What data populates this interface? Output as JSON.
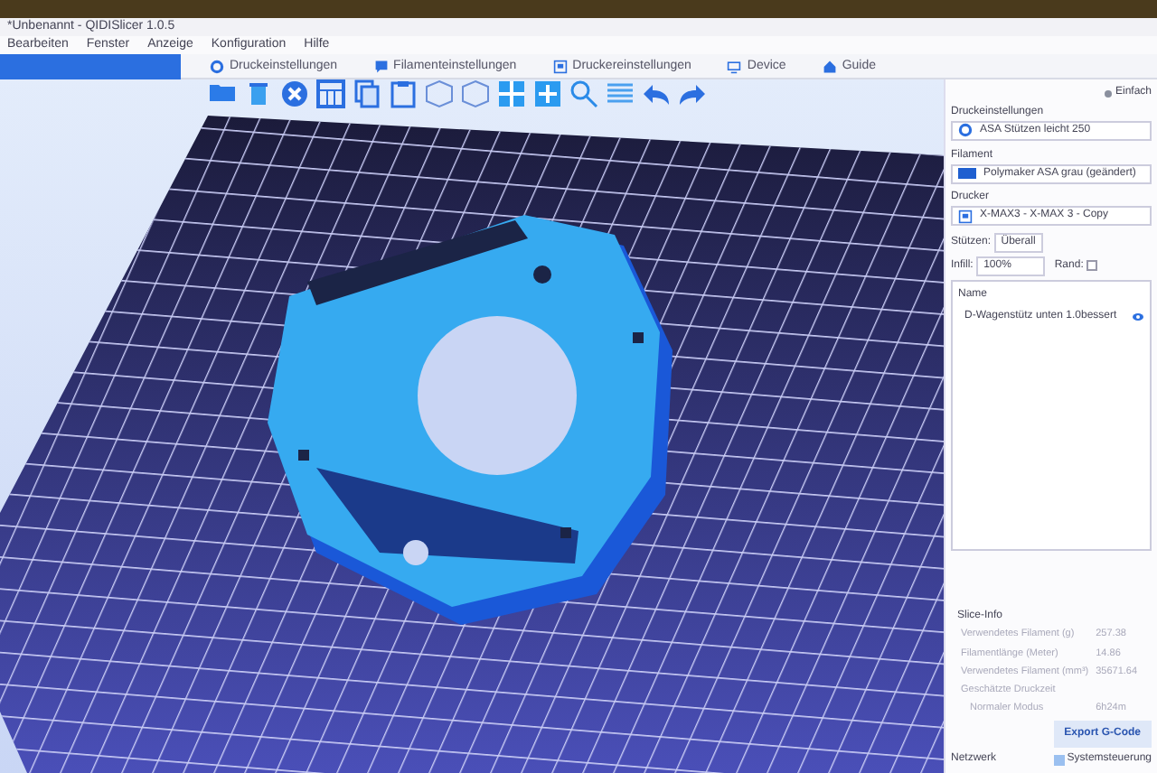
{
  "window": {
    "title": "*Unbenannt - QIDISlicer 1.0.5"
  },
  "menu": [
    "Bearbeiten",
    "Fenster",
    "Anzeige",
    "Konfiguration",
    "Hilfe"
  ],
  "tabs": [
    {
      "kind": "plater",
      "selected": true
    },
    {
      "kind": "gear",
      "label": "Druckeinstellungen",
      "selected": false
    },
    {
      "kind": "spool",
      "label": "Filamenteinstellungen",
      "selected": false
    },
    {
      "kind": "printer",
      "label": "Druckereinstellungen",
      "selected": false
    },
    {
      "kind": "device",
      "label": "Device",
      "selected": false
    },
    {
      "kind": "home",
      "label": "Guide",
      "selected": false
    }
  ],
  "sidebar": {
    "mode": "Einfach",
    "presets": [
      {
        "label": "Druckeinstellungen",
        "value": "ASA Stützen leicht 250",
        "kind": "gear"
      },
      {
        "label": "Filament",
        "value": "Polymaker ASA grau (geändert)",
        "kind": "swatch",
        "color": "#1f5fd0"
      },
      {
        "label": "Drucker",
        "value": "X-MAX3 - X-MAX 3 - Copy",
        "kind": "printer"
      }
    ],
    "supports": {
      "label": "Stützen:",
      "value": "Überall"
    },
    "infill": {
      "label": "Infill:",
      "value": "100%"
    },
    "brim": {
      "label": "Rand:",
      "checked": false
    },
    "objects": {
      "header": "Name",
      "rows": [
        {
          "name": "D-Wagenstütz unten 1.0bessert",
          "visible": true
        }
      ]
    }
  },
  "slice_info": {
    "title": "Slice-Info",
    "rows": [
      {
        "label": "Verwendetes Filament (g)",
        "value": "257.38"
      },
      {
        "label": "Filamentlänge (Meter)",
        "value": "14.86"
      },
      {
        "label": "Verwendetes Filament (mm³)",
        "value": "35671.64"
      },
      {
        "label": "Geschätzte Druckzeit",
        "value": ""
      }
    ],
    "time": {
      "label": "Normaler Modus",
      "value": "6h24m"
    },
    "export": "Export G-Code"
  },
  "status_bar": {
    "left": "Netzwerk",
    "right": "Systemsteuerung"
  }
}
